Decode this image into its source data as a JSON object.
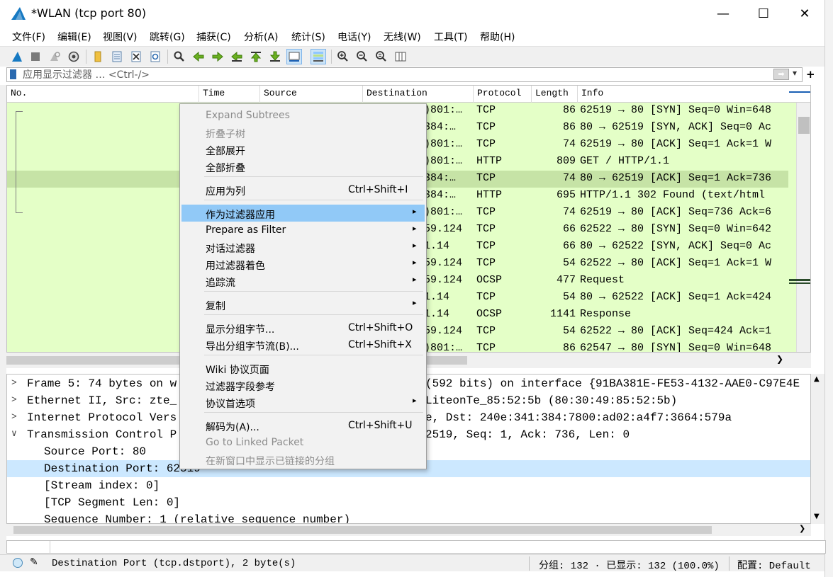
{
  "window": {
    "title": "*WLAN (tcp port 80)",
    "minimize_glyph": "—",
    "maximize_glyph": "☐",
    "close_glyph": "✕"
  },
  "menu": [
    {
      "label": "文件(F)"
    },
    {
      "label": "编辑(E)"
    },
    {
      "label": "视图(V)"
    },
    {
      "label": "跳转(G)"
    },
    {
      "label": "捕获(C)"
    },
    {
      "label": "分析(A)"
    },
    {
      "label": "统计(S)"
    },
    {
      "label": "电话(Y)"
    },
    {
      "label": "无线(W)"
    },
    {
      "label": "工具(T)"
    },
    {
      "label": "帮助(H)"
    }
  ],
  "toolbar": {
    "icons": [
      "start-capture-icon",
      "stop-capture-icon",
      "restart-capture-icon",
      "capture-options-icon",
      "open-file-icon",
      "save-file-icon",
      "close-file-icon",
      "reload-file-icon",
      "find-packet-icon",
      "go-back-icon",
      "go-forward-icon",
      "go-to-packet-icon",
      "go-first-icon",
      "go-last-icon",
      "autoscroll-icon",
      "colorize-icon",
      "zoom-in-icon",
      "zoom-out-icon",
      "zoom-normal-icon",
      "resize-columns-icon"
    ]
  },
  "filter": {
    "placeholder": "应用显示过滤器 … <Ctrl-/>",
    "apply_glyph": "➡",
    "dropdown_glyph": "▾",
    "add_glyph": "+"
  },
  "packet_list": {
    "columns": [
      "No.",
      "Time",
      "Source",
      "Destination",
      "Protocol",
      "Length",
      "Info"
    ],
    "rows": [
      {
        "dest": ")801:…",
        "proto": "TCP",
        "len": "86",
        "info": "62519 → 80 [SYN] Seq=0 Win=648"
      },
      {
        "dest": "384:…",
        "proto": "TCP",
        "len": "86",
        "info": "80 → 62519 [SYN, ACK] Seq=0 Ac"
      },
      {
        "dest": ")801:…",
        "proto": "TCP",
        "len": "74",
        "info": "62519 → 80 [ACK] Seq=1 Ack=1 W"
      },
      {
        "dest": ")801:…",
        "proto": "HTTP",
        "len": "809",
        "info": "GET / HTTP/1.1"
      },
      {
        "dest": "384:…",
        "proto": "TCP",
        "len": "74",
        "info": "80 → 62519 [ACK] Seq=1 Ack=736"
      },
      {
        "dest": "384:…",
        "proto": "HTTP",
        "len": "695",
        "info": "HTTP/1.1 302 Found  (text/html"
      },
      {
        "dest": ")801:…",
        "proto": "TCP",
        "len": "74",
        "info": "62519 → 80 [ACK] Seq=736 Ack=6"
      },
      {
        "dest": "59.124",
        "proto": "TCP",
        "len": "66",
        "info": "62522 → 80 [SYN] Seq=0 Win=642"
      },
      {
        "dest": "1.14",
        "proto": "TCP",
        "len": "66",
        "info": "80 → 62522 [SYN, ACK] Seq=0 Ac"
      },
      {
        "dest": "59.124",
        "proto": "TCP",
        "len": "54",
        "info": "62522 → 80 [ACK] Seq=1 Ack=1 W"
      },
      {
        "dest": "59.124",
        "proto": "OCSP",
        "len": "477",
        "info": "Request"
      },
      {
        "dest": "1.14",
        "proto": "TCP",
        "len": "54",
        "info": "80 → 62522 [ACK] Seq=1 Ack=424"
      },
      {
        "dest": "1.14",
        "proto": "OCSP",
        "len": "1141",
        "info": "Response"
      },
      {
        "dest": "59.124",
        "proto": "TCP",
        "len": "54",
        "info": "62522 → 80 [ACK] Seq=424 Ack=1"
      },
      {
        "dest": ")801:…",
        "proto": "TCP",
        "len": "86",
        "info": "62547 → 80 [SYN] Seq=0 Win=648"
      }
    ]
  },
  "details": {
    "rows": [
      {
        "arrow": ">",
        "left": "Frame 5: 74 bytes on w",
        "right": "(592 bits) on interface {91BA381E-FE53-4132-AAE0-C97E4E"
      },
      {
        "arrow": ">",
        "left": "Ethernet II, Src: zte_",
        "right": "LiteonTe_85:52:5b (80:30:49:85:52:5b)"
      },
      {
        "arrow": ">",
        "left": "Internet Protocol Vers",
        "right": "e, Dst: 240e:341:384:7800:ad02:a4f7:3664:579a"
      },
      {
        "arrow": "∨",
        "left": "Transmission Control P",
        "right": "2519, Seq: 1, Ack: 736, Len: 0"
      },
      {
        "arrow": "",
        "left": "Source Port: 80",
        "right": ""
      },
      {
        "arrow": "",
        "left": "Destination Port: 62519",
        "right": ""
      },
      {
        "arrow": "",
        "left": "[Stream index: 0]",
        "right": ""
      },
      {
        "arrow": "",
        "left": "[TCP Segment Len: 0]",
        "right": ""
      },
      {
        "arrow": "",
        "left": "Sequence Number: 1    (relative sequence number)",
        "right": ""
      }
    ]
  },
  "context_menu": {
    "items": [
      {
        "label": "Expand Subtrees",
        "shortcut": "",
        "submenu": false,
        "disabled": true
      },
      {
        "label": "折叠子树",
        "shortcut": "",
        "submenu": false,
        "disabled": true
      },
      {
        "label": "全部展开",
        "shortcut": "",
        "submenu": false,
        "disabled": false
      },
      {
        "label": "全部折叠",
        "shortcut": "",
        "submenu": false,
        "disabled": false
      },
      {
        "label": "应用为列",
        "shortcut": "Ctrl+Shift+I",
        "submenu": false,
        "disabled": false
      },
      {
        "label": "作为过滤器应用",
        "shortcut": "",
        "submenu": true,
        "disabled": false,
        "highlighted": true
      },
      {
        "label": "Prepare as Filter",
        "shortcut": "",
        "submenu": true,
        "disabled": false
      },
      {
        "label": "对话过滤器",
        "shortcut": "",
        "submenu": true,
        "disabled": false
      },
      {
        "label": "用过滤器着色",
        "shortcut": "",
        "submenu": true,
        "disabled": false
      },
      {
        "label": "追踪流",
        "shortcut": "",
        "submenu": true,
        "disabled": false
      },
      {
        "label": "复制",
        "shortcut": "",
        "submenu": true,
        "disabled": false
      },
      {
        "label": "显示分组字节...",
        "shortcut": "Ctrl+Shift+O",
        "submenu": false,
        "disabled": false
      },
      {
        "label": "导出分组字节流(B)...",
        "shortcut": "Ctrl+Shift+X",
        "submenu": false,
        "disabled": false
      },
      {
        "label": "Wiki 协议页面",
        "shortcut": "",
        "submenu": false,
        "disabled": false
      },
      {
        "label": "过滤器字段参考",
        "shortcut": "",
        "submenu": false,
        "disabled": false
      },
      {
        "label": "协议首选项",
        "shortcut": "",
        "submenu": true,
        "disabled": false
      },
      {
        "label": "解码为(A)...",
        "shortcut": "Ctrl+Shift+U",
        "submenu": false,
        "disabled": false
      },
      {
        "label": "Go to Linked Packet",
        "shortcut": "",
        "submenu": false,
        "disabled": true
      },
      {
        "label": "在新窗口中显示已链接的分组",
        "shortcut": "",
        "submenu": false,
        "disabled": true
      }
    ]
  },
  "statusbar": {
    "field_text": "Destination Port (tcp.dstport), 2 byte(s)",
    "packets": "分组: 132 · 已显示: 132 (100.0%)",
    "profile": "配置: Default"
  },
  "colors": {
    "packet_bg": "#e4ffc7",
    "packet_selected": "#c6e3a6",
    "menu_highlight": "#91c9f7",
    "detail_selected": "#cce8ff"
  }
}
